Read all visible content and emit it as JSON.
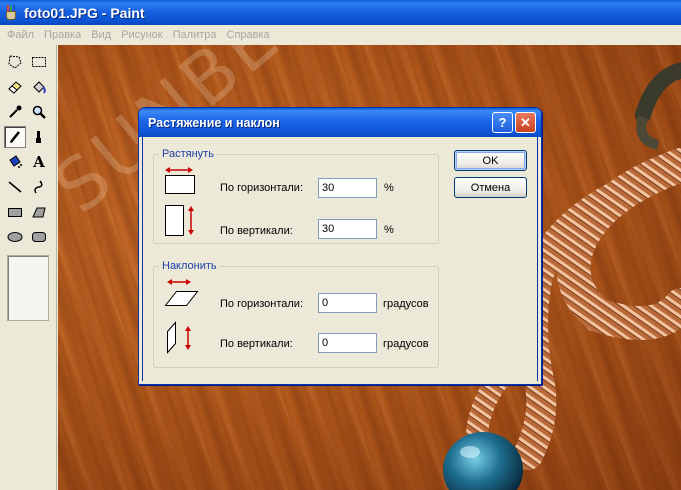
{
  "window": {
    "title": "foto01.JPG - Paint"
  },
  "menu": [
    "Файл",
    "Правка",
    "Вид",
    "Рисунок",
    "Палитра",
    "Справка"
  ],
  "toolbox": {
    "tools": [
      {
        "name": "free-form-select",
        "icon": "free-form-select-icon"
      },
      {
        "name": "rect-select",
        "icon": "rect-select-icon"
      },
      {
        "name": "eraser",
        "icon": "eraser-icon"
      },
      {
        "name": "fill",
        "icon": "paint-bucket-icon"
      },
      {
        "name": "pick-color",
        "icon": "eyedropper-icon"
      },
      {
        "name": "magnifier",
        "icon": "magnifier-icon"
      },
      {
        "name": "pencil",
        "icon": "pencil-icon",
        "active": true
      },
      {
        "name": "brush",
        "icon": "brush-icon"
      },
      {
        "name": "airbrush",
        "icon": "airbrush-icon"
      },
      {
        "name": "text",
        "icon": "text-icon"
      },
      {
        "name": "line",
        "icon": "line-icon"
      },
      {
        "name": "curve",
        "icon": "curve-icon"
      },
      {
        "name": "rectangle",
        "icon": "rectangle-icon"
      },
      {
        "name": "polygon",
        "icon": "polygon-icon"
      },
      {
        "name": "ellipse",
        "icon": "ellipse-icon"
      },
      {
        "name": "rounded-rectangle",
        "icon": "rounded-rectangle-icon"
      }
    ]
  },
  "canvas": {
    "watermark": "SUNBEADS.RU"
  },
  "dialog": {
    "title": "Растяжение и наклон",
    "help_label": "?",
    "close_label": "✕",
    "stretch": {
      "legend": "Растянуть",
      "horizontal_label": "По горизонтали:",
      "horizontal_value": "30",
      "horizontal_unit": "%",
      "vertical_label": "По вертикали:",
      "vertical_value": "30",
      "vertical_unit": "%"
    },
    "skew": {
      "legend": "Наклонить",
      "horizontal_label": "По горизонтали:",
      "horizontal_value": "0",
      "horizontal_unit": "градусов",
      "vertical_label": "По вертикали:",
      "vertical_value": "0",
      "vertical_unit": "градусов"
    },
    "ok_label": "OK",
    "cancel_label": "Отмена"
  },
  "colors": {
    "titlebar": "#0a5ad8",
    "dialog_face": "#ece9d8",
    "group_legend": "#1c3fa8",
    "arrow_red": "#cc0000"
  }
}
